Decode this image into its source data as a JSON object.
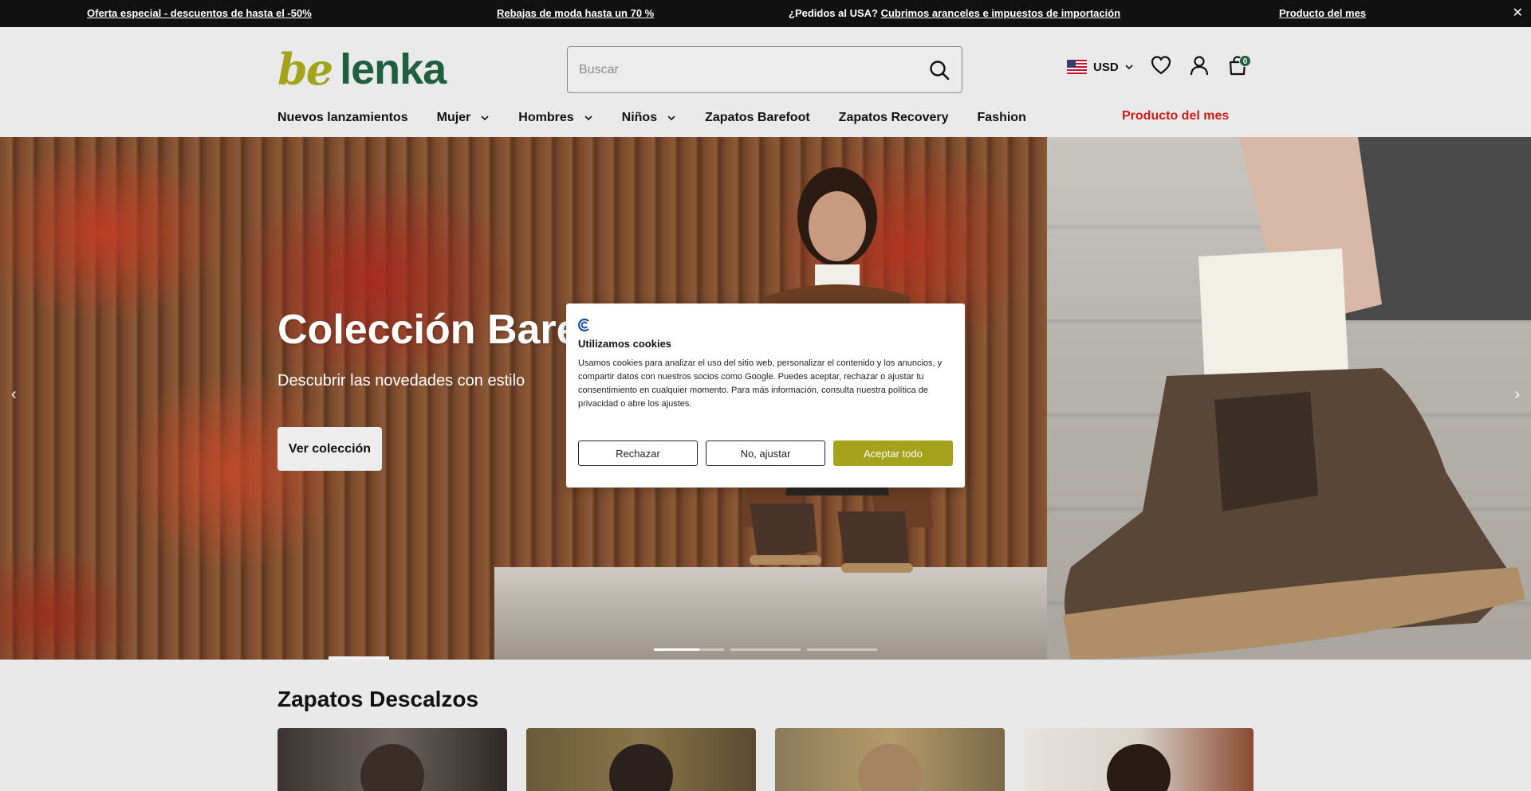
{
  "promo": {
    "item1": "Oferta especial - descuentos de hasta el -50%",
    "item2": "Rebajas de moda hasta un 70 %",
    "item3_prefix": "¿Pedidos al USA?",
    "item3_link": "Cubrimos aranceles e impuestos de importación",
    "item4": "Producto del mes",
    "close": "✕"
  },
  "header": {
    "logo_be": "be",
    "logo_lenka": "lenka",
    "search_placeholder": "Buscar",
    "currency": "USD",
    "cart_count": "0"
  },
  "nav": {
    "items": [
      {
        "label": "Nuevos lanzamientos"
      },
      {
        "label": "Mujer"
      },
      {
        "label": "Hombres"
      },
      {
        "label": "Niños"
      },
      {
        "label": "Zapatos Barefoot"
      },
      {
        "label": "Zapatos Recovery"
      },
      {
        "label": "Fashion"
      }
    ],
    "featured": "Producto del mes"
  },
  "hero": {
    "title": "Colección Barefo",
    "subtitle": "Descubrir las novedades con estilo",
    "button": "Ver colección",
    "prev": "‹",
    "next": "›",
    "slide_count": 3,
    "active_slide": 1
  },
  "cookie": {
    "title": "Utilizamos cookies",
    "body": "Usamos cookies para analizar el uso del sitio web, personalizar el contenido y los anuncios, y compartir datos con nuestros socios como Google. Puedes aceptar, rechazar o ajustar tu consentimiento en cualquier momento. Para más información, consulta nuestra política de privacidad o abre los ajustes.",
    "reject": "Rechazar",
    "adjust": "No, ajustar",
    "accept": "Aceptar todo"
  },
  "section": {
    "title": "Zapatos Descalzos"
  },
  "colors": {
    "brand_green": "#1f5f3e",
    "brand_olive": "#a3a41a",
    "accept_button": "#a6a21c",
    "featured_red": "#cc1b1b"
  }
}
